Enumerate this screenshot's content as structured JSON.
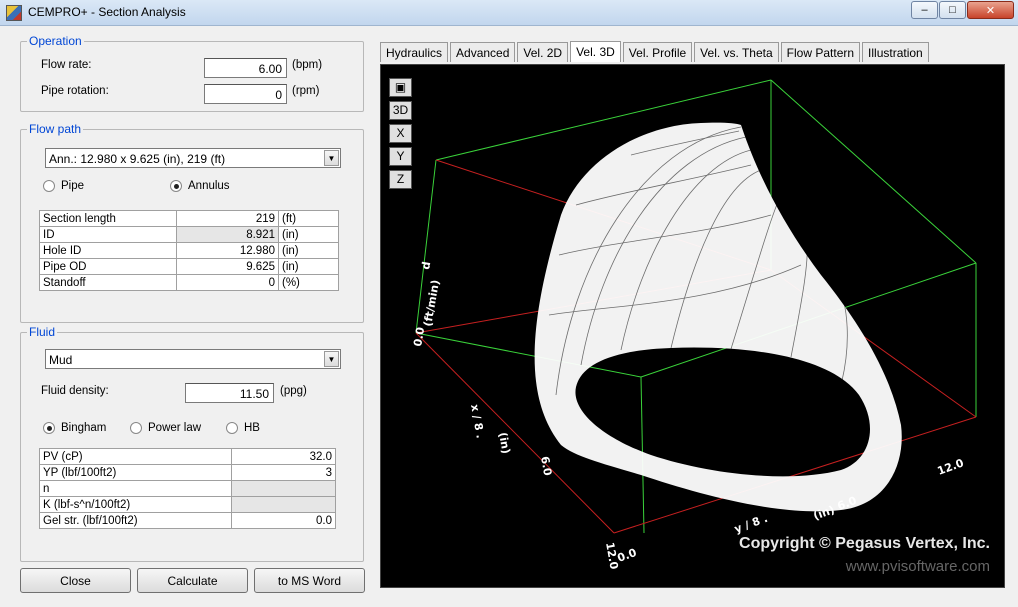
{
  "window": {
    "title": "CEMPRO+ - Section Analysis"
  },
  "operation": {
    "legend": "Operation",
    "flow_rate_label": "Flow rate:",
    "flow_rate": "6.00",
    "flow_rate_unit": "(bpm)",
    "rotation_label": "Pipe rotation:",
    "rotation": "0",
    "rotation_unit": "(rpm)"
  },
  "flow_path": {
    "legend": "Flow path",
    "selected": "Ann.: 12.980 x 9.625 (in), 219 (ft)",
    "radio_pipe": "Pipe",
    "radio_annulus": "Annulus",
    "rows": [
      {
        "label": "Section length",
        "value": "219",
        "unit": "(ft)"
      },
      {
        "label": "ID",
        "value": "8.921",
        "unit": "(in)"
      },
      {
        "label": "Hole ID",
        "value": "12.980",
        "unit": "(in)"
      },
      {
        "label": "Pipe OD",
        "value": "9.625",
        "unit": "(in)"
      },
      {
        "label": "Standoff",
        "value": "0",
        "unit": "(%)"
      }
    ]
  },
  "fluid": {
    "legend": "Fluid",
    "selected": "Mud",
    "density_label": "Fluid density:",
    "density": "11.50",
    "density_unit": "(ppg)",
    "radio_bingham": "Bingham",
    "radio_power": "Power law",
    "radio_hb": "HB",
    "rows": [
      {
        "label": "PV (cP)",
        "value": "32.0"
      },
      {
        "label": "YP (lbf/100ft2)",
        "value": "3"
      },
      {
        "label": "n",
        "value": ""
      },
      {
        "label": "K (lbf-s^n/100ft2)",
        "value": ""
      },
      {
        "label": "Gel str. (lbf/100ft2)",
        "value": "0.0"
      }
    ]
  },
  "buttons": {
    "close": "Close",
    "calculate": "Calculate",
    "word": "to MS Word"
  },
  "tabs": [
    "Hydraulics",
    "Advanced",
    "Vel. 2D",
    "Vel. 3D",
    "Vel. Profile",
    "Vel. vs. Theta",
    "Flow Pattern",
    "Illustration"
  ],
  "view_buttons": {
    "b3d": "3D",
    "x": "X",
    "y": "Y",
    "z": "Z"
  },
  "plot": {
    "axis_labels": {
      "y_unit": "(ft/min)",
      "dx": "d",
      "ax": "x / 8 .",
      "ax_unit": "(in)",
      "ay": "y / 8 .",
      "ay_unit": "(in)"
    },
    "ticks": {
      "x_end": "12.0",
      "y_end": "12.0",
      "origin": "0.0",
      "x_mid": "6.0",
      "y_mid": "6.0",
      "z_zero": "0.0"
    },
    "copyright": "Copyright © Pegasus Vertex, Inc.",
    "website": "www.pvisoftware.com"
  }
}
